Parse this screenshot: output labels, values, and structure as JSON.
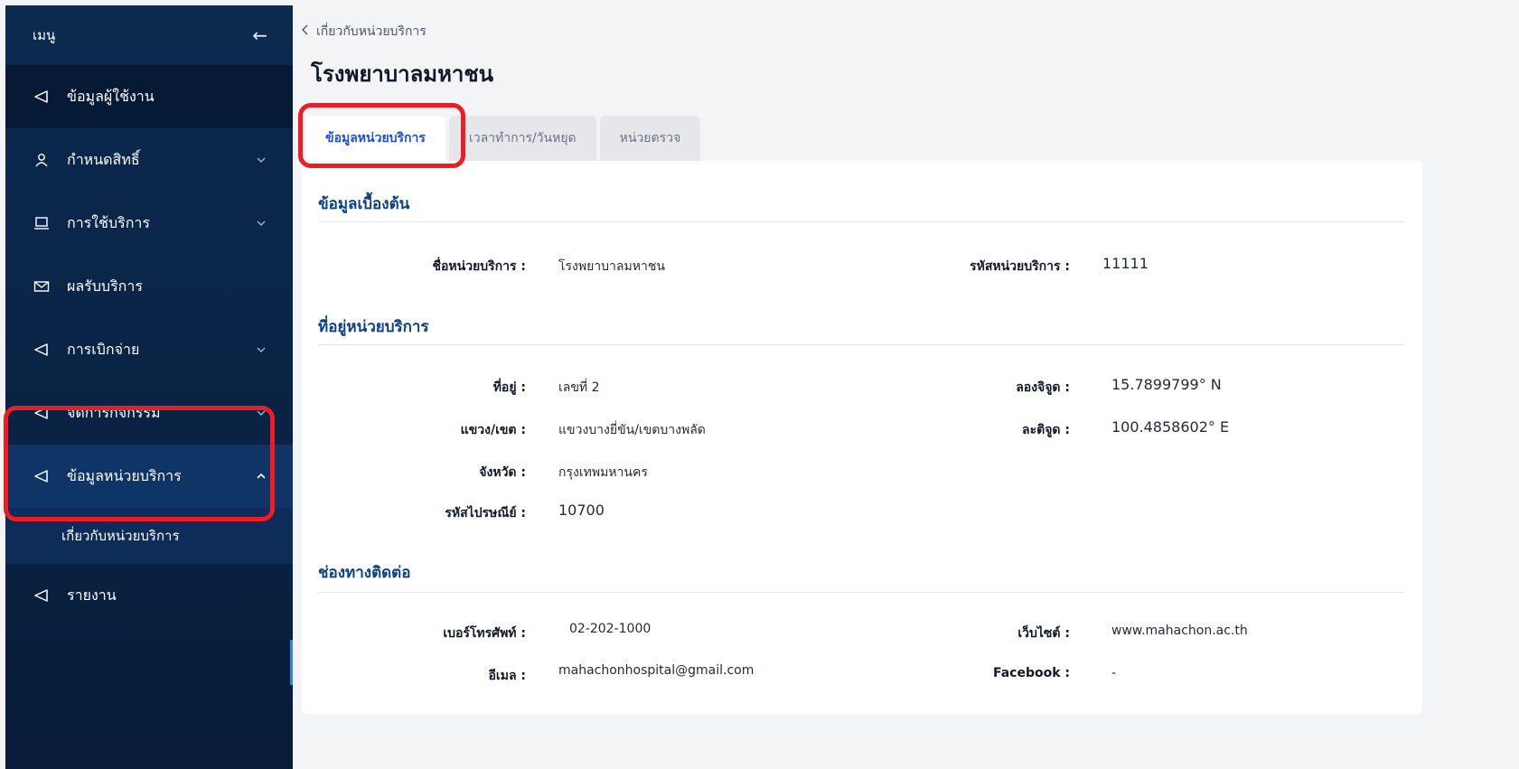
{
  "sidebar": {
    "header": "เมนู",
    "items": [
      {
        "label": "ข้อมูลผู้ใช้งาน"
      },
      {
        "label": "กำหนดสิทธิ์"
      },
      {
        "label": "การใช้บริการ"
      },
      {
        "label": "ผลรับบริการ"
      },
      {
        "label": "การเบิกจ่าย"
      },
      {
        "label": "จัดการกิจกรรม"
      },
      {
        "label": "ข้อมูลหน่วยบริการ"
      },
      {
        "label": "รายงาน"
      }
    ],
    "sub_item": "เกี่ยวกับหน่วยบริการ"
  },
  "breadcrumb": "เกี่ยวกับหน่วยบริการ",
  "page_title": "โรงพยาบาลมหาชน",
  "tabs": [
    {
      "label": "ข้อมูลหน่วยบริการ"
    },
    {
      "label": "เวลาทำการ/วันหยุด"
    },
    {
      "label": "หน่วยตรวจ"
    }
  ],
  "sections": {
    "basic": {
      "title": "ข้อมูลเบื้องต้น",
      "name_label": "ชื่อหน่วยบริการ :",
      "name_value": "โรงพยาบาลมหาชน",
      "code_label": "รหัสหน่วยบริการ :",
      "code_value": "11111"
    },
    "address": {
      "title": "ที่อยู่หน่วยบริการ",
      "addr_label": "ที่อยู่ :",
      "addr_value": "เลขที่ 2",
      "district_label": "แขวง/เขต :",
      "district_value": "แขวงบางยี่ขัน/เขตบางพลัด",
      "province_label": "จังหวัด :",
      "province_value": "กรุงเทพมหานคร",
      "zip_label": "รหัสไปรษณีย์ :",
      "zip_value": "10700",
      "lat_label": "ลองจิจูด :",
      "lat_value": "15.7899799° N",
      "lng_label": "ละติจูด :",
      "lng_value": "100.4858602° E"
    },
    "contact": {
      "title": "ช่องทางติดต่อ",
      "phone_label": "เบอร์โทรศัพท์ :",
      "phone_value": "02-202-1000",
      "email_label": "อีเมล :",
      "email_value": "mahachonhospital@gmail.com",
      "web_label": "เว็บไซต์ :",
      "web_value": "www.mahachon.ac.th",
      "fb_label": "Facebook :",
      "fb_value": "-"
    }
  },
  "colors": {
    "sidebar_bg": "#0a2548",
    "accent": "#0b3f86",
    "highlight": "#ef1c24"
  }
}
